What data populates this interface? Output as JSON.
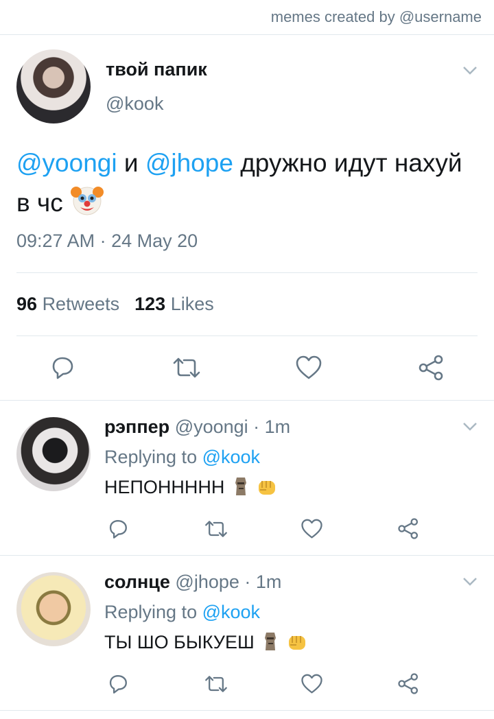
{
  "watermark": "memes created by @username",
  "main_tweet": {
    "display_name": "твой папик",
    "handle": "@kook",
    "text_mention_1": "@yoongi",
    "text_and": " и ",
    "text_mention_2": "@jhope",
    "text_rest": " дружно идут нахуй в чс ",
    "emoji": "clown-face",
    "timestamp": "09:27 AM · 24 May 20",
    "retweets_count": "96",
    "retweets_label": "Retweets",
    "likes_count": "123",
    "likes_label": "Likes"
  },
  "replies": [
    {
      "display_name": "рэппер",
      "handle_time": " @yoongi · 1m",
      "replying_prefix": "Replying to ",
      "replying_handle": "@kook",
      "text": "НЕПОННННН",
      "emojis": [
        "moai",
        "oncoming-fist"
      ]
    },
    {
      "display_name": "солнце",
      "handle_time": " @jhope · 1m",
      "replying_prefix": "Replying to ",
      "replying_handle": "@kook",
      "text": "ТЫ ШО БЫКУЕШ ",
      "emojis": [
        "moai",
        "oncoming-fist"
      ]
    }
  ],
  "colors": {
    "link": "#1da1f2",
    "secondary_text": "#657786",
    "divider": "#e1e8ed",
    "icon": "#657786"
  }
}
